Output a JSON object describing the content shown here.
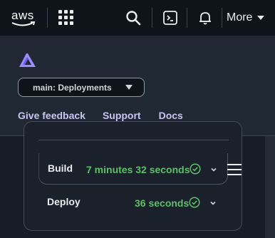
{
  "topbar": {
    "logo_text": "aws",
    "more_label": "More",
    "icons": [
      "aws-logo",
      "app-grid-icon",
      "search-icon",
      "cloudshell-icon",
      "bell-icon",
      "caret-down-icon"
    ]
  },
  "panel": {
    "logo_icon": "amplify-logo",
    "branch_select": {
      "value": "main: Deployments"
    },
    "links": [
      "Give feedback",
      "Support",
      "Docs"
    ]
  },
  "pipeline": {
    "steps": [
      {
        "name": "Build",
        "duration": "7 minutes 32 seconds",
        "status": "success"
      },
      {
        "name": "Deploy",
        "duration": "36 seconds",
        "status": "success"
      }
    ]
  },
  "colors": {
    "topbar_bg": "#0f141a",
    "panel_bg": "#1f2833",
    "link": "#c6c6f2",
    "success": "#5fbf69",
    "logo_accent": "#9b8cff"
  }
}
